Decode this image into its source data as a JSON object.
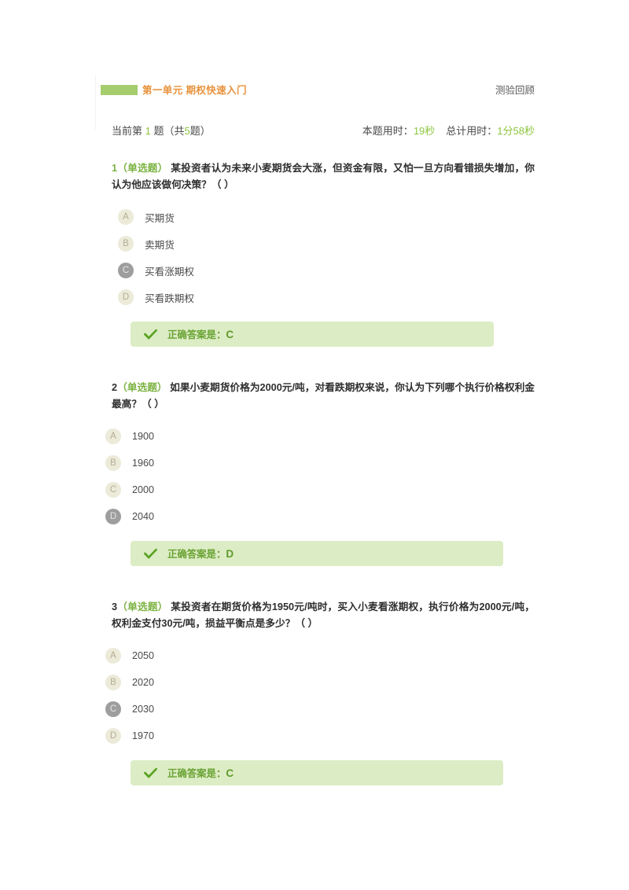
{
  "header": {
    "unit_title": "第一单元  期权快速入门",
    "review_link": "测验回顾",
    "accent_orange": "#e8923c",
    "bar_green": "#a5cd6e"
  },
  "status": {
    "current_prefix": "当前第 ",
    "current_number": "1",
    "current_mid": " 题（共",
    "total_number": "5",
    "current_suffix": "题）",
    "question_time_label": "本题用时：",
    "question_time_value": "19秒",
    "total_time_label": "总计用时：",
    "total_time_value": "1分58秒",
    "highlight_green": "#8cc63e"
  },
  "questions": [
    {
      "number": "1",
      "type": "（单选题）",
      "text": "某投资者认为未来小麦期货会大涨，但资金有限，又怕一旦方向看错损失增加，你认为他应该做何决策？（    ）",
      "options": [
        {
          "letter": "A",
          "label": "买期货",
          "selected": false
        },
        {
          "letter": "B",
          "label": "卖期货",
          "selected": false
        },
        {
          "letter": "C",
          "label": "买看涨期权",
          "selected": true
        },
        {
          "letter": "D",
          "label": "买看跌期权",
          "selected": false
        }
      ],
      "answer_label": "正确答案是：",
      "answer_letter": "C"
    },
    {
      "number": "2",
      "type": "（单选题）",
      "text": "如果小麦期货价格为2000元/吨，对看跌期权来说，你认为下列哪个执行价格权利金最高？（    ）",
      "options": [
        {
          "letter": "A",
          "label": "1900",
          "selected": false
        },
        {
          "letter": "B",
          "label": "1960",
          "selected": false
        },
        {
          "letter": "C",
          "label": "2000",
          "selected": false
        },
        {
          "letter": "D",
          "label": "2040",
          "selected": true
        }
      ],
      "answer_label": "正确答案是：",
      "answer_letter": "D"
    },
    {
      "number": "3",
      "type": "（单选题）",
      "text": "某投资者在期货价格为1950元/吨时，买入小麦看涨期权，执行价格为2000元/吨，权利金支付30元/吨，损益平衡点是多少？（    ）",
      "options": [
        {
          "letter": "A",
          "label": "2050",
          "selected": false
        },
        {
          "letter": "B",
          "label": "2020",
          "selected": false
        },
        {
          "letter": "C",
          "label": "2030",
          "selected": true
        },
        {
          "letter": "D",
          "label": "1970",
          "selected": false
        }
      ],
      "answer_label": "正确答案是：",
      "answer_letter": "C"
    }
  ],
  "icons": {
    "check": "check-icon"
  }
}
